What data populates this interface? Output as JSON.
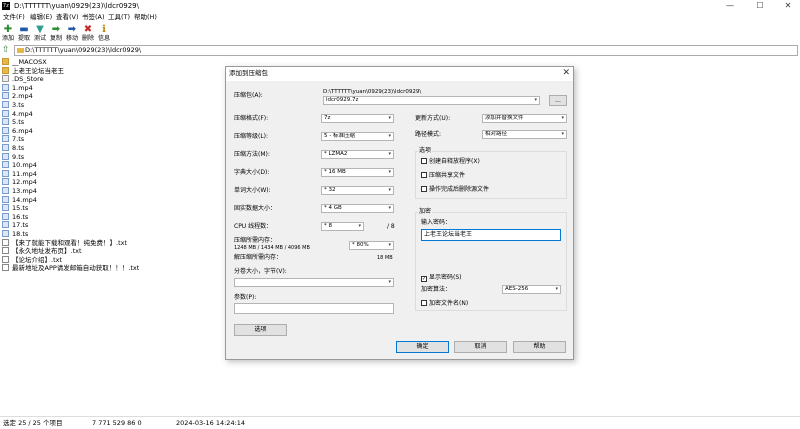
{
  "window": {
    "title": "D:\\TTTTTT\\yuan\\0929(23)\\ldcr0929\\",
    "app_icon": "7z",
    "minimize": "—",
    "maximize": "☐",
    "close": "✕"
  },
  "menu": [
    "文件(F)",
    "编辑(E)",
    "查看(V)",
    "书签(A)",
    "工具(T)",
    "帮助(H)"
  ],
  "toolbar": [
    {
      "label": "添加",
      "icon": "add-icon",
      "glyph": "✚",
      "color": "#2e8b2e"
    },
    {
      "label": "提取",
      "icon": "extract-icon",
      "glyph": "▬",
      "color": "#1e5aa8"
    },
    {
      "label": "测试",
      "icon": "test-icon",
      "glyph": "▼",
      "color": "#2a9d8f"
    },
    {
      "label": "复制",
      "icon": "copy-icon",
      "glyph": "➡",
      "color": "#2e8b2e"
    },
    {
      "label": "移动",
      "icon": "move-icon",
      "glyph": "➡",
      "color": "#1e5aa8"
    },
    {
      "label": "删除",
      "icon": "delete-icon",
      "glyph": "✖",
      "color": "#c62828"
    },
    {
      "label": "信息",
      "icon": "info-icon",
      "glyph": "ℹ",
      "color": "#b8860b"
    }
  ],
  "address": {
    "path": "D:\\TTTTTT\\yuan\\0929(23)\\ldcr0929\\"
  },
  "files": [
    {
      "name": "__MACOSX",
      "type": "folder"
    },
    {
      "name": "上老王论坛当老王",
      "type": "folder"
    },
    {
      "name": ".DS_Store",
      "type": "store"
    },
    {
      "name": "1.mp4",
      "type": "video"
    },
    {
      "name": "2.mp4",
      "type": "video"
    },
    {
      "name": "3.ts",
      "type": "video"
    },
    {
      "name": "4.mp4",
      "type": "video"
    },
    {
      "name": "5.ts",
      "type": "video"
    },
    {
      "name": "6.mp4",
      "type": "video"
    },
    {
      "name": "7.ts",
      "type": "video"
    },
    {
      "name": "8.ts",
      "type": "video"
    },
    {
      "name": "9.ts",
      "type": "video"
    },
    {
      "name": "10.mp4",
      "type": "video"
    },
    {
      "name": "11.mp4",
      "type": "video"
    },
    {
      "name": "12.mp4",
      "type": "video"
    },
    {
      "name": "13.mp4",
      "type": "video"
    },
    {
      "name": "14.mp4",
      "type": "video"
    },
    {
      "name": "15.ts",
      "type": "video"
    },
    {
      "name": "16.ts",
      "type": "video"
    },
    {
      "name": "17.ts",
      "type": "video"
    },
    {
      "name": "18.ts",
      "type": "video"
    },
    {
      "name": "【来了就能下载和观看！纯免费！】.txt",
      "type": "txt"
    },
    {
      "name": "【永久地址发布页】.txt",
      "type": "txt"
    },
    {
      "name": "【论坛介绍】.txt",
      "type": "txt"
    },
    {
      "name": "最新地址及APP请发邮箱自动获取！！！.txt",
      "type": "txt"
    }
  ],
  "status": {
    "selection": "选定 25 / 25 个项目",
    "size": "7 771 529 86 0",
    "modified": "2024-03-16 14:24:14"
  },
  "dialog": {
    "title": "添加到压缩包",
    "archive_label": "压缩包(A):",
    "archive_path": "D:\\TTTTTT\\yuan\\0929(23)\\ldcr0929\\",
    "archive_name": "ldcr0929.7z",
    "browse": "...",
    "format_label": "压缩格式(F):",
    "format_value": "7z",
    "level_label": "压缩等级(L):",
    "level_value": "5 - 标准压缩",
    "method_label": "压缩方法(M):",
    "method_value": "* LZMA2",
    "dict_label": "字典大小(D):",
    "dict_value": "* 16 MB",
    "word_label": "单词大小(W):",
    "word_value": "* 32",
    "solid_label": "固实数据大小：",
    "solid_value": "* 4 GB",
    "threads_label": "CPU 线程数：",
    "threads_value": "* 8",
    "threads_total": "/ 8",
    "mem_comp_label": "压缩所需内存：",
    "mem_comp_value": "1248 MB / 1434 MB / 4096 MB",
    "mem_pct": "* 80%",
    "mem_decomp_label": "解压缩所需内存：",
    "mem_decomp_value": "18 MB",
    "split_label": "分卷大小，字节(V):",
    "split_value": "",
    "params_label": "参数(P):",
    "params_value": "",
    "options_btn": "选项",
    "update_label": "更新方式(U):",
    "update_value": "添加并替换文件",
    "pathmode_label": "路径模式:",
    "pathmode_value": "相对路径",
    "options_title": "选项",
    "opt_sfx": "创建自释放程序(X)",
    "opt_shared": "压缩共享文件",
    "opt_delete": "操作完成后删除源文件",
    "enc_title": "加密",
    "pwd_label": "输入密码：",
    "pwd_value": "上老王论坛当老王",
    "show_pwd": "显示密码(S)",
    "show_pwd_checked": "✓",
    "enc_method_label": "加密算法：",
    "enc_method_value": "AES-256",
    "enc_names": "加密文件名(N)",
    "ok": "确定",
    "cancel": "取消",
    "help": "帮助"
  },
  "colors": {
    "accent": "#0078d7",
    "folder": "#e6b84a"
  }
}
